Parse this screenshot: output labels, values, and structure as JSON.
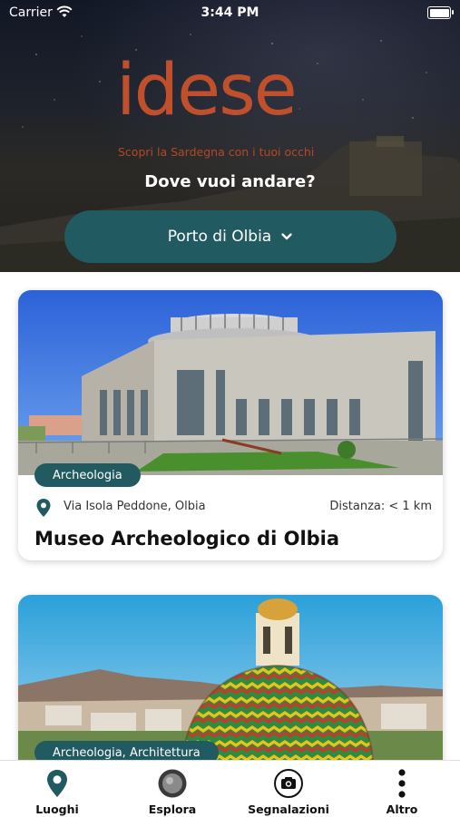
{
  "status_bar": {
    "carrier": "Carrier",
    "time": "3:44 PM"
  },
  "hero": {
    "logo": "idese",
    "tagline": "Scopri la Sardegna con i tuoi occhi",
    "question": "Dove vuoi andare?",
    "location_selector": {
      "value": "Porto di Olbia"
    }
  },
  "places": [
    {
      "category": "Archeologia",
      "address": "Via Isola Peddone, Olbia",
      "distance": "Distanza: < 1 km",
      "title": "Museo Archeologico di Olbia"
    },
    {
      "category": "Archeologia, Architettura"
    }
  ],
  "tabbar": [
    {
      "label": "Luoghi",
      "icon": "map-pin-icon"
    },
    {
      "label": "Esplora",
      "icon": "globe-icon"
    },
    {
      "label": "Segnalazioni",
      "icon": "camera-icon"
    },
    {
      "label": "Altro",
      "icon": "more-vertical-icon"
    }
  ],
  "colors": {
    "accent": "#225a62",
    "brand": "#c0502c"
  }
}
